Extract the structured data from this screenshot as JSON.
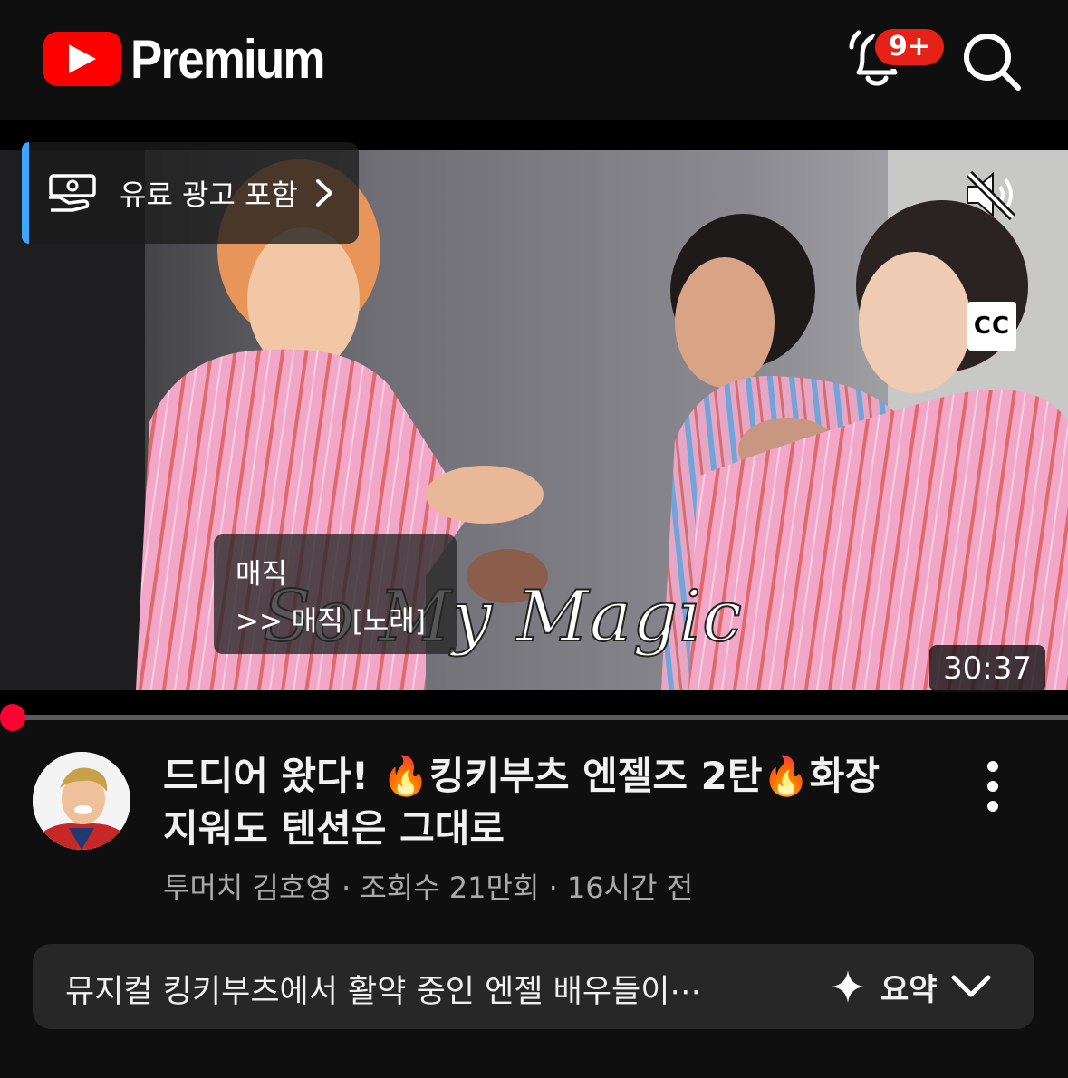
{
  "header": {
    "app_name": "Premium",
    "logo_icon": "youtube-play-icon",
    "notifications_badge": "9+",
    "notifications_icon": "bell-icon",
    "search_icon": "search-icon"
  },
  "player": {
    "paid_promotion_label": "유료 광고 포함",
    "paid_promotion_icon": "paid-promotion-icon",
    "mute_icon": "volume-muted-icon",
    "cc_label": "CC",
    "caption_line1": "매직",
    "caption_line2": ">> 매직 [노래]",
    "burned_in_text": "So My Magic",
    "duration": "30:37",
    "progress": 0.0
  },
  "video": {
    "title": "드디어 왔다! 🔥킹키부츠 엔젤즈 2탄🔥화장 지워도 텐션은 그대로",
    "channel": "투머치 김호영",
    "views": "조회수 21만회",
    "age": "16시간 전",
    "separator": " · ",
    "more_icon": "more-vert-icon"
  },
  "summary": {
    "text": "뮤지컬 킹키부츠에서 활약 중인 엔젤 배우들이⋯",
    "action_label": "요약",
    "sparkle_icon": "sparkle-icon",
    "chevron_icon": "chevron-down-icon"
  },
  "colors": {
    "background": "#0f0f0f",
    "brand_red": "#ff0000",
    "progress": "#ff0033",
    "accent_blue": "#3ea6ff",
    "secondary_text": "#aaaaaa",
    "card": "#272727"
  }
}
